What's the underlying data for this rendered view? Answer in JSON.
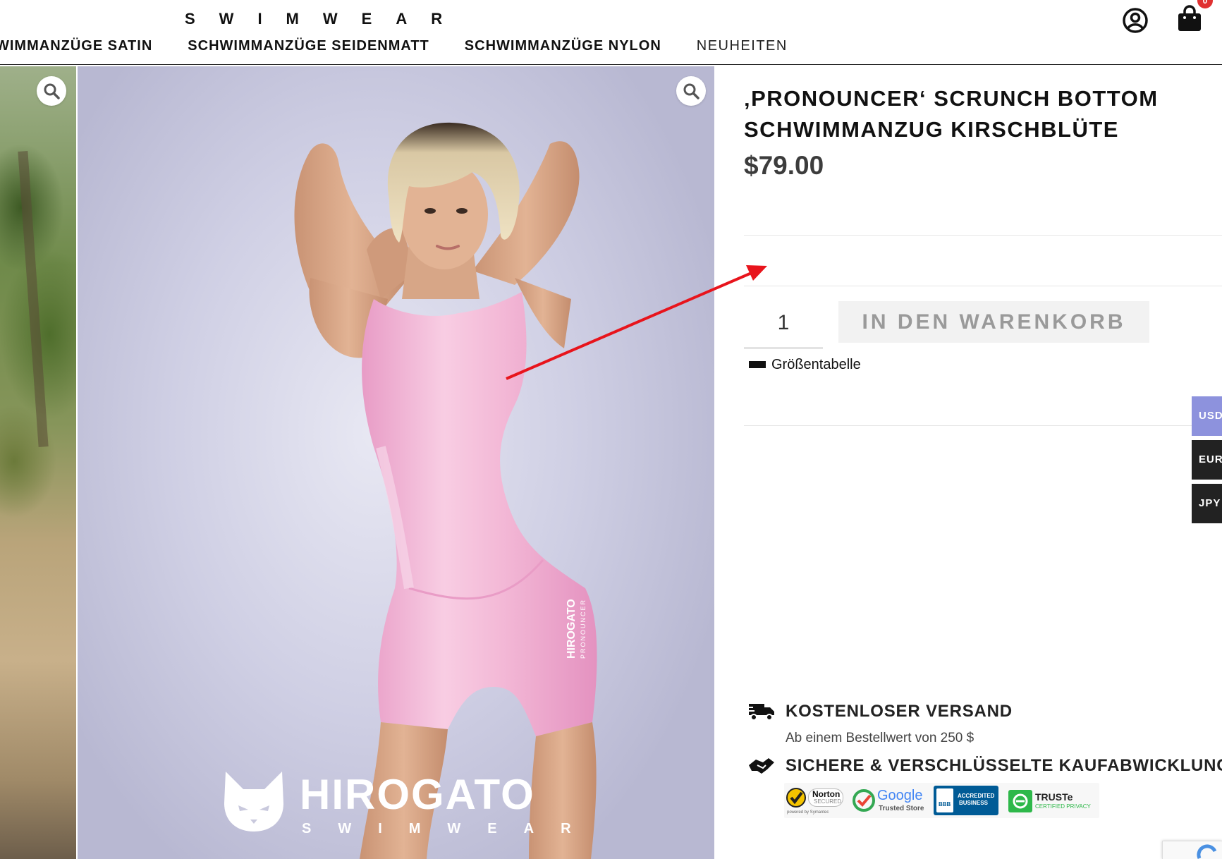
{
  "header": {
    "logo_subtitle": "SWIMWEAR",
    "nav": [
      "WIMMANZÜGE SATIN",
      "SCHWIMMANZÜGE SEIDENMATT",
      "SCHWIMMANZÜGE NYLON",
      "NEUHEITEN"
    ],
    "cart_count": "0"
  },
  "product": {
    "title_line1": "‚PRONOUNCER‘ SCRUNCH BOTTOM",
    "title_line2": "SCHWIMMANZUG KIRSCHBLÜTE",
    "price": "$79.00",
    "quantity": "1",
    "add_to_cart": "IN DEN WARENKORB",
    "size_chart": "Größentabelle"
  },
  "gallery": {
    "watermark_brand": "HIROGATO",
    "watermark_sub": "SWIMWEAR",
    "suit_print_brand": "HIROGATO",
    "suit_print_sub": "PRONOUNCER"
  },
  "currencies": [
    {
      "code": "USD",
      "color": "#8d92dd"
    },
    {
      "code": "EUR",
      "color": "#222222"
    },
    {
      "code": "JPY",
      "color": "#222222"
    }
  ],
  "features": {
    "shipping_title": "KOSTENLOSER VERSAND",
    "shipping_sub": "Ab einem Bestellwert von 250 $",
    "secure_title": "SICHERE & VERSCHLÜSSELTE KAUFABWICKLUNG"
  },
  "trust_badges": {
    "norton_line1": "Norton",
    "norton_line2": "SECURED",
    "norton_line3": "powered by Symantec",
    "google_line1": "Google",
    "google_line2": "Trusted Store",
    "bbb_line1": "ACCREDITED",
    "bbb_line2": "BUSINESS",
    "bbb_mark": "BBB",
    "truste_line1": "TRUSTe",
    "truste_line2": "CERTIFIED PRIVACY"
  },
  "colors": {
    "annotation_arrow": "#e8141c",
    "suit_pink": "#f3b8d6"
  }
}
